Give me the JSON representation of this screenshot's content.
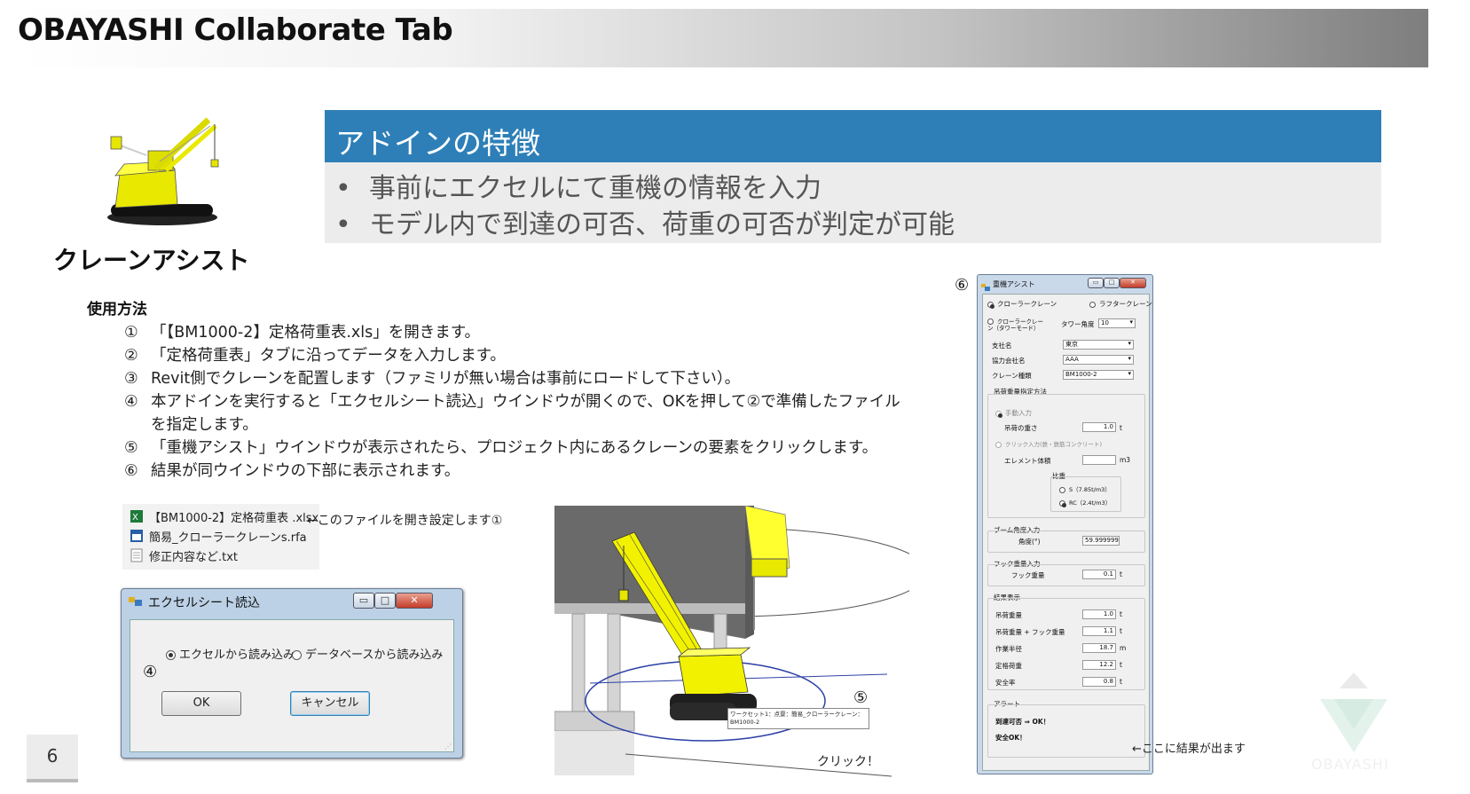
{
  "header": {
    "title": "OBAYASHI Collaborate Tab"
  },
  "product": {
    "name": "クレーンアシスト"
  },
  "features": {
    "heading": "アドインの特徴",
    "items": [
      "事前にエクセルにて重機の情報を入力",
      "モデル内で到達の可否、荷重の可否が判定が可能"
    ]
  },
  "usage": {
    "label": "使用方法",
    "steps": [
      {
        "num": "①",
        "text": "「【BM1000-2】定格荷重表.xls」を開きます。"
      },
      {
        "num": "②",
        "text": "「定格荷重表」タブに沿ってデータを入力します。"
      },
      {
        "num": "③",
        "text": "Revit側でクレーンを配置します（ファミリが無い場合は事前にロードして下さい）。"
      },
      {
        "num": "④",
        "text": "本アドインを実行すると「エクセルシート読込」ウインドウが開くので、OKを押して②で準備したファイル",
        "cont": "を指定します。"
      },
      {
        "num": "⑤",
        "text": "「重機アシスト」ウインドウが表示されたら、プロジェクト内にあるクレーンの要素をクリックします。"
      },
      {
        "num": "⑥",
        "text": "結果が同ウインドウの下部に表示されます。"
      }
    ]
  },
  "files": {
    "items": [
      {
        "name": "【BM1000-2】定格荷重表 .xlsx",
        "icon": "excel-file-icon"
      },
      {
        "name": "簡易_クローラークレーンs.rfa",
        "icon": "revit-family-icon"
      },
      {
        "name": "修正内容など.txt",
        "icon": "text-file-icon"
      }
    ],
    "note": "←このファイルを開き設定します①"
  },
  "excel_dialog": {
    "title": "エクセルシート読込",
    "option_excel": "エクセルから読み込み",
    "option_db": "データベースから読み込み",
    "ok": "OK",
    "cancel": "キャンセル",
    "marker": "④"
  },
  "viewport": {
    "tooltip_line1": "ワークセット1：点景：簡易_クローラークレーン：",
    "tooltip_line2": "BM1000-2",
    "click_label": "クリック！",
    "marker": "⑤"
  },
  "crane_window": {
    "marker": "⑥",
    "title": "重機アシスト",
    "radio_crawler": "クローラークレーン",
    "radio_tower": "ラフタークレーン",
    "radio_crawler_tower": "クローラークレーン（タワーモード）",
    "tower_angle_label": "タワー角度",
    "tower_angle_value": "10",
    "branch_label": "支社名",
    "branch_value": "東京",
    "company_label": "協力会社名",
    "company_value": "AAA",
    "crane_type_label": "クレーン種類",
    "crane_type_value": "BM1000-2",
    "load_method_label": "吊荷重量指定方法",
    "manual_input": "手動入力",
    "load_weight_label": "吊荷の重さ",
    "load_weight_value": "1.0",
    "unit_t": "t",
    "click_input": "クリック入力(鉄・鉄筋コンクリート)",
    "element_volume_label": "エレメント体積",
    "unit_m3": "m3",
    "density_label": "比重",
    "density_s": "S（7.85t/m3）",
    "density_rc": "RC（2.4t/m3）",
    "boom_angle_group": "ブーム角度入力",
    "angle_label": "角度(°)",
    "angle_value": "59.999999",
    "hook_group": "フック重量入力",
    "hook_label": "フック重量",
    "hook_value": "0.1",
    "result_group": "結果表示",
    "res_load_label": "吊荷重量",
    "res_load_value": "1.0",
    "res_total_label": "吊荷重量 + フック重量",
    "res_total_value": "1.1",
    "res_radius_label": "作業半径",
    "res_radius_value": "18.7",
    "unit_m": "m",
    "res_rated_label": "定格荷重",
    "res_rated_value": "12.2",
    "res_safety_label": "安全率",
    "res_safety_value": "0.8",
    "alert_group": "アラート",
    "reach_text": "到達可否 ⇒ OK！",
    "safety_ok_text": "安全OK！",
    "result_note": "←ここに結果が出ます"
  },
  "footer": {
    "page_number": "6",
    "logo_text": "OBAYASHI"
  },
  "colors": {
    "feature_bar": "#2e7fb8",
    "crane_yellow": "#f2f200",
    "crane_dark": "#1f1f1f"
  }
}
